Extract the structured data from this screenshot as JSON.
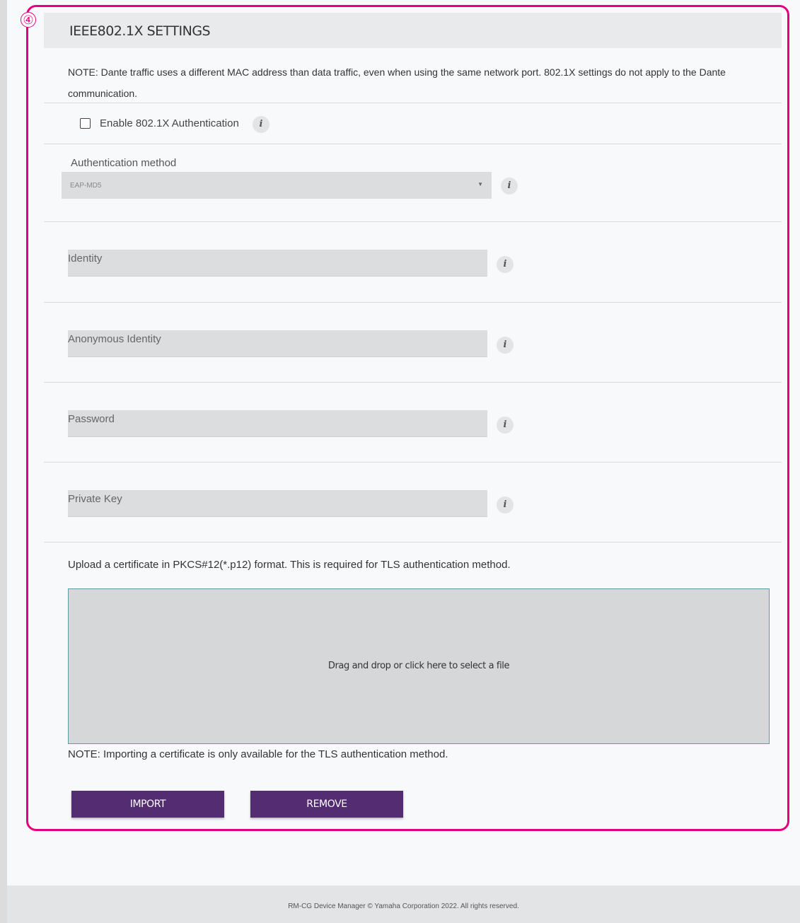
{
  "marker": "④",
  "section": {
    "title": "IEEE802.1X SETTINGS"
  },
  "note_top": "NOTE: Dante traffic uses a different MAC address than data traffic, even when using the same network port. 802.1X settings do not apply to the Dante communication.",
  "enable_checkbox": {
    "label": "Enable 802.1X Authentication",
    "checked": false
  },
  "info_icon": "i",
  "auth_method": {
    "label": "Authentication method",
    "value": "EAP-MD5"
  },
  "fields": {
    "identity": "Identity",
    "anonymous_identity": "Anonymous Identity",
    "password": "Password",
    "private_key": "Private Key"
  },
  "upload": {
    "description": "Upload a certificate in PKCS#12(*.p12) format. This is required for TLS authentication method.",
    "dropzone_text": "Drag and drop or click here to select a file",
    "note": "NOTE: Importing a certificate is only available for the TLS authentication method."
  },
  "buttons": {
    "import": "IMPORT",
    "remove": "REMOVE"
  },
  "footer": {
    "text": "RM-CG Device Manager © Yamaha Corporation 2022. All rights reserved."
  },
  "colors": {
    "highlight": "#e5007e",
    "button": "#532c72",
    "dropzone_border": "#5f9aa1"
  }
}
